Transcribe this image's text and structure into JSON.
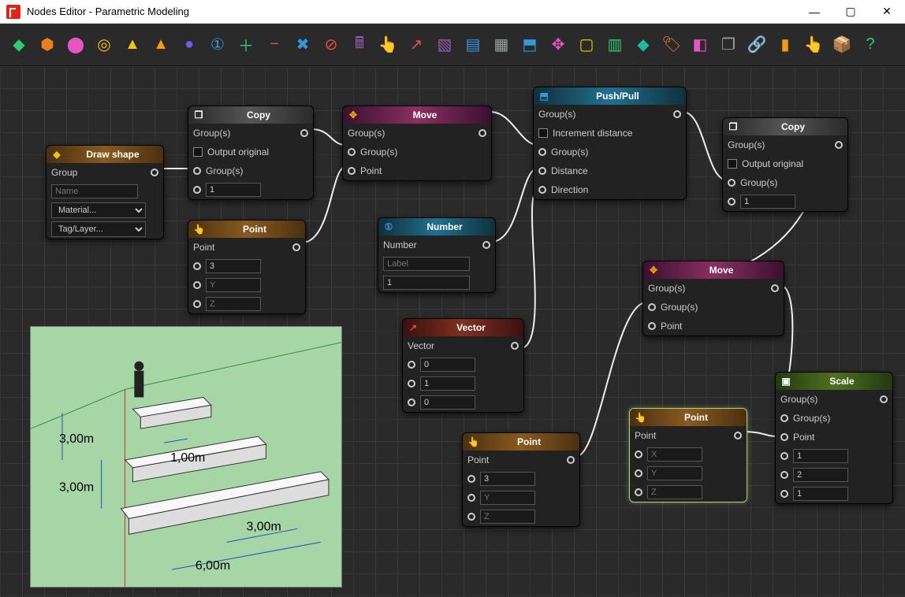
{
  "window": {
    "title": "Nodes Editor - Parametric Modeling"
  },
  "toolbar_icons": [
    {
      "name": "diamond",
      "glyph": "◆",
      "color": "#2ecc71"
    },
    {
      "name": "cube",
      "glyph": "⬢",
      "color": "#e67e22"
    },
    {
      "name": "cylinder",
      "glyph": "⬤",
      "color": "#e754c4"
    },
    {
      "name": "torus",
      "glyph": "◎",
      "color": "#f1c40f"
    },
    {
      "name": "pyramid",
      "glyph": "▲",
      "color": "#f1c40f"
    },
    {
      "name": "cone",
      "glyph": "▲",
      "color": "#f39c12"
    },
    {
      "name": "sphere",
      "glyph": "●",
      "color": "#6c5ce7"
    },
    {
      "name": "number1",
      "glyph": "①",
      "color": "#3498db"
    },
    {
      "name": "add",
      "glyph": "＋",
      "color": "#2ecc71"
    },
    {
      "name": "subtract",
      "glyph": "−",
      "color": "#e74c3c"
    },
    {
      "name": "multiply",
      "glyph": "✖",
      "color": "#3498db"
    },
    {
      "name": "divide",
      "glyph": "⊘",
      "color": "#e74c3c"
    },
    {
      "name": "calculator",
      "glyph": "🖩",
      "color": "#9b59b6"
    },
    {
      "name": "pointer",
      "glyph": "👆",
      "color": "#f39c12"
    },
    {
      "name": "vector",
      "glyph": "↗",
      "color": "#e74c3c"
    },
    {
      "name": "rect1",
      "glyph": "▧",
      "color": "#9b59b6"
    },
    {
      "name": "rect2",
      "glyph": "▤",
      "color": "#3498db"
    },
    {
      "name": "rect3",
      "glyph": "▦",
      "color": "#95a5a6"
    },
    {
      "name": "pushpull",
      "glyph": "⬒",
      "color": "#3498db"
    },
    {
      "name": "move",
      "glyph": "✥",
      "color": "#e754c4"
    },
    {
      "name": "rect4",
      "glyph": "▢",
      "color": "#f1c40f"
    },
    {
      "name": "rect5",
      "glyph": "▥",
      "color": "#2ecc71"
    },
    {
      "name": "paint",
      "glyph": "◆",
      "color": "#1abc9c"
    },
    {
      "name": "tag",
      "glyph": "🏷",
      "color": "#e67e22"
    },
    {
      "name": "eraser",
      "glyph": "◧",
      "color": "#e754c4"
    },
    {
      "name": "copy",
      "glyph": "❐",
      "color": "#95a5a6"
    },
    {
      "name": "link",
      "glyph": "🔗",
      "color": "#f1c40f"
    },
    {
      "name": "select",
      "glyph": "▮",
      "color": "#f39c12"
    },
    {
      "name": "pointer2",
      "glyph": "👆",
      "color": "#f39c12"
    },
    {
      "name": "box",
      "glyph": "📦",
      "color": "#2ecc71"
    },
    {
      "name": "help",
      "glyph": "?",
      "color": "#2ecc71"
    }
  ],
  "nodes": {
    "drawshape": {
      "title": "Draw shape",
      "out": "Group",
      "name_ph": "Name",
      "material": "Material...",
      "tag": "Tag/Layer..."
    },
    "copy1": {
      "title": "Copy",
      "out": "Group(s)",
      "opt": "Output original",
      "in1": "Group(s)",
      "count": "1"
    },
    "point1": {
      "title": "Point",
      "out": "Point",
      "x": "3",
      "y": "Y",
      "z": "Z"
    },
    "move1": {
      "title": "Move",
      "out": "Group(s)",
      "in1": "Group(s)",
      "in2": "Point"
    },
    "number": {
      "title": "Number",
      "out": "Number",
      "label_ph": "Label",
      "val": "1"
    },
    "vector": {
      "title": "Vector",
      "out": "Vector",
      "x": "0",
      "y": "1",
      "z": "0"
    },
    "pushpull": {
      "title": "Push/Pull",
      "out": "Group(s)",
      "chk": "Increment distance",
      "in1": "Group(s)",
      "in2": "Distance",
      "in3": "Direction"
    },
    "point2": {
      "title": "Point",
      "out": "Point",
      "x": "3",
      "y": "Y",
      "z": "Z"
    },
    "point3": {
      "title": "Point",
      "out": "Point",
      "x": "X",
      "y": "Y",
      "z": "Z"
    },
    "copy2": {
      "title": "Copy",
      "out": "Group(s)",
      "opt": "Output original",
      "in1": "Group(s)",
      "count": "1"
    },
    "move2": {
      "title": "Move",
      "out": "Group(s)",
      "in1": "Group(s)",
      "in2": "Point"
    },
    "scale": {
      "title": "Scale",
      "out": "Group(s)",
      "in1": "Group(s)",
      "in2": "Point",
      "sx": "1",
      "sy": "2",
      "sz": "1"
    }
  },
  "preview": {
    "dims": [
      "3,00m",
      "3,00m",
      "1,00m",
      "3,00m",
      "6,00m"
    ]
  }
}
